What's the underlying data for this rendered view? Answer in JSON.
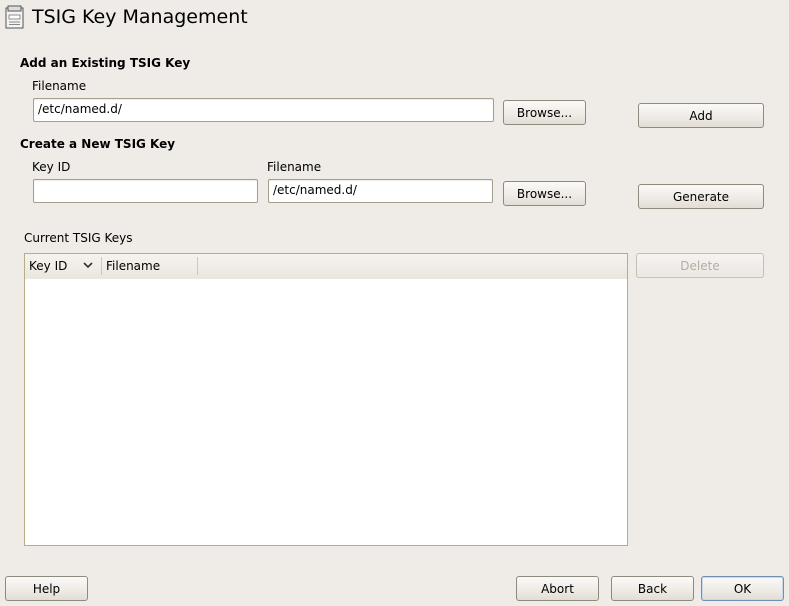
{
  "window": {
    "title": "TSIG Key Management"
  },
  "add_section": {
    "heading": "Add an Existing TSIG Key",
    "filename_label": "Filename",
    "filename_value": "/etc/named.d/",
    "browse_label": "Browse...",
    "add_label": "Add"
  },
  "create_section": {
    "heading": "Create a New TSIG Key",
    "key_id_label": "Key ID",
    "key_id_value": "",
    "filename_label": "Filename",
    "filename_value": "/etc/named.d/",
    "browse_label": "Browse...",
    "generate_label": "Generate"
  },
  "keys_section": {
    "label": "Current TSIG Keys",
    "columns": [
      "Key ID",
      "Filename"
    ],
    "sort_column": "Key ID",
    "rows": [],
    "delete_label": "Delete"
  },
  "footer": {
    "help_label": "Help",
    "abort_label": "Abort",
    "back_label": "Back",
    "ok_label": "OK"
  },
  "colors": {
    "background": "#efebe7",
    "list_border": "#b7ac88",
    "default_button_border": "#6f8fb3"
  }
}
